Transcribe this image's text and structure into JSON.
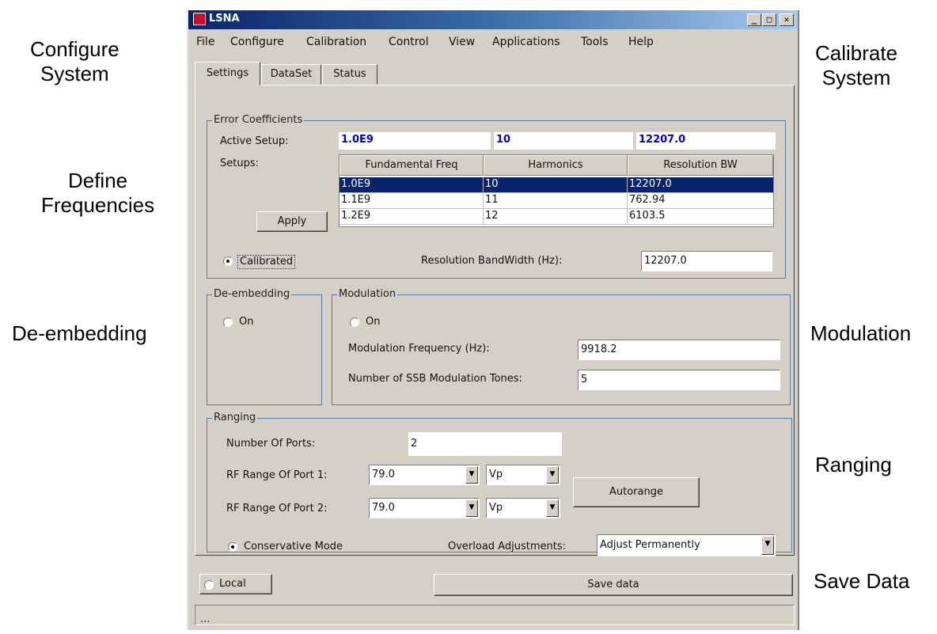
{
  "annotations": {
    "configure": "Configure\nSystem",
    "calibrate": "Calibrate\nSystem",
    "frequencies": "Define\nFrequencies",
    "deembedding": "De-embedding",
    "modulation": "Modulation",
    "ranging": "Ranging",
    "save": "Save Data"
  },
  "window": {
    "title": "LSNA",
    "minimize": "_",
    "maximize": "□",
    "close": "✕"
  },
  "menu": [
    "File",
    "Configure",
    "Calibration",
    "Control",
    "View",
    "Applications",
    "Tools",
    "Help"
  ],
  "tabs": [
    "Settings",
    "DataSet",
    "Status"
  ],
  "error_coefficients": {
    "title": "Error Coefficients",
    "active_label": "Active Setup:",
    "active": [
      "1.0E9",
      "10",
      "12207.0"
    ],
    "setups_label": "Setups:",
    "columns": [
      "Fundamental Freq",
      "Harmonics",
      "Resolution BW"
    ],
    "rows": [
      [
        "1.0E9",
        "10",
        "12207.0"
      ],
      [
        "1.1E9",
        "11",
        "762.94"
      ],
      [
        "1.2E9",
        "12",
        "6103.5"
      ]
    ],
    "selected_row": 0,
    "apply": "Apply",
    "calibrated": "Calibrated",
    "rbw_label": "Resolution BandWidth (Hz):",
    "rbw_value": "12207.0"
  },
  "deembedding": {
    "title": "De-embedding",
    "on": "On"
  },
  "modulation": {
    "title": "Modulation",
    "on": "On",
    "freq_label": "Modulation Frequency (Hz):",
    "freq_value": "9918.2",
    "tones_label": "Number of SSB Modulation Tones:",
    "tones_value": "5"
  },
  "ranging": {
    "title": "Ranging",
    "ports_label": "Number Of Ports:",
    "ports_value": "2",
    "port1_label": "RF Range Of Port 1:",
    "port1_value": "79.0",
    "port1_unit": "Vp",
    "port2_label": "RF Range Of Port 2:",
    "port2_value": "79.0",
    "port2_unit": "Vp",
    "autorange": "Autorange",
    "conservative": "Conservative Mode",
    "overload_label": "Overload Adjustments:",
    "overload_value": "Adjust Permanently"
  },
  "bottom": {
    "local": "Local",
    "save": "Save data",
    "status": "..."
  },
  "icons": {
    "dropdown": "▼"
  }
}
